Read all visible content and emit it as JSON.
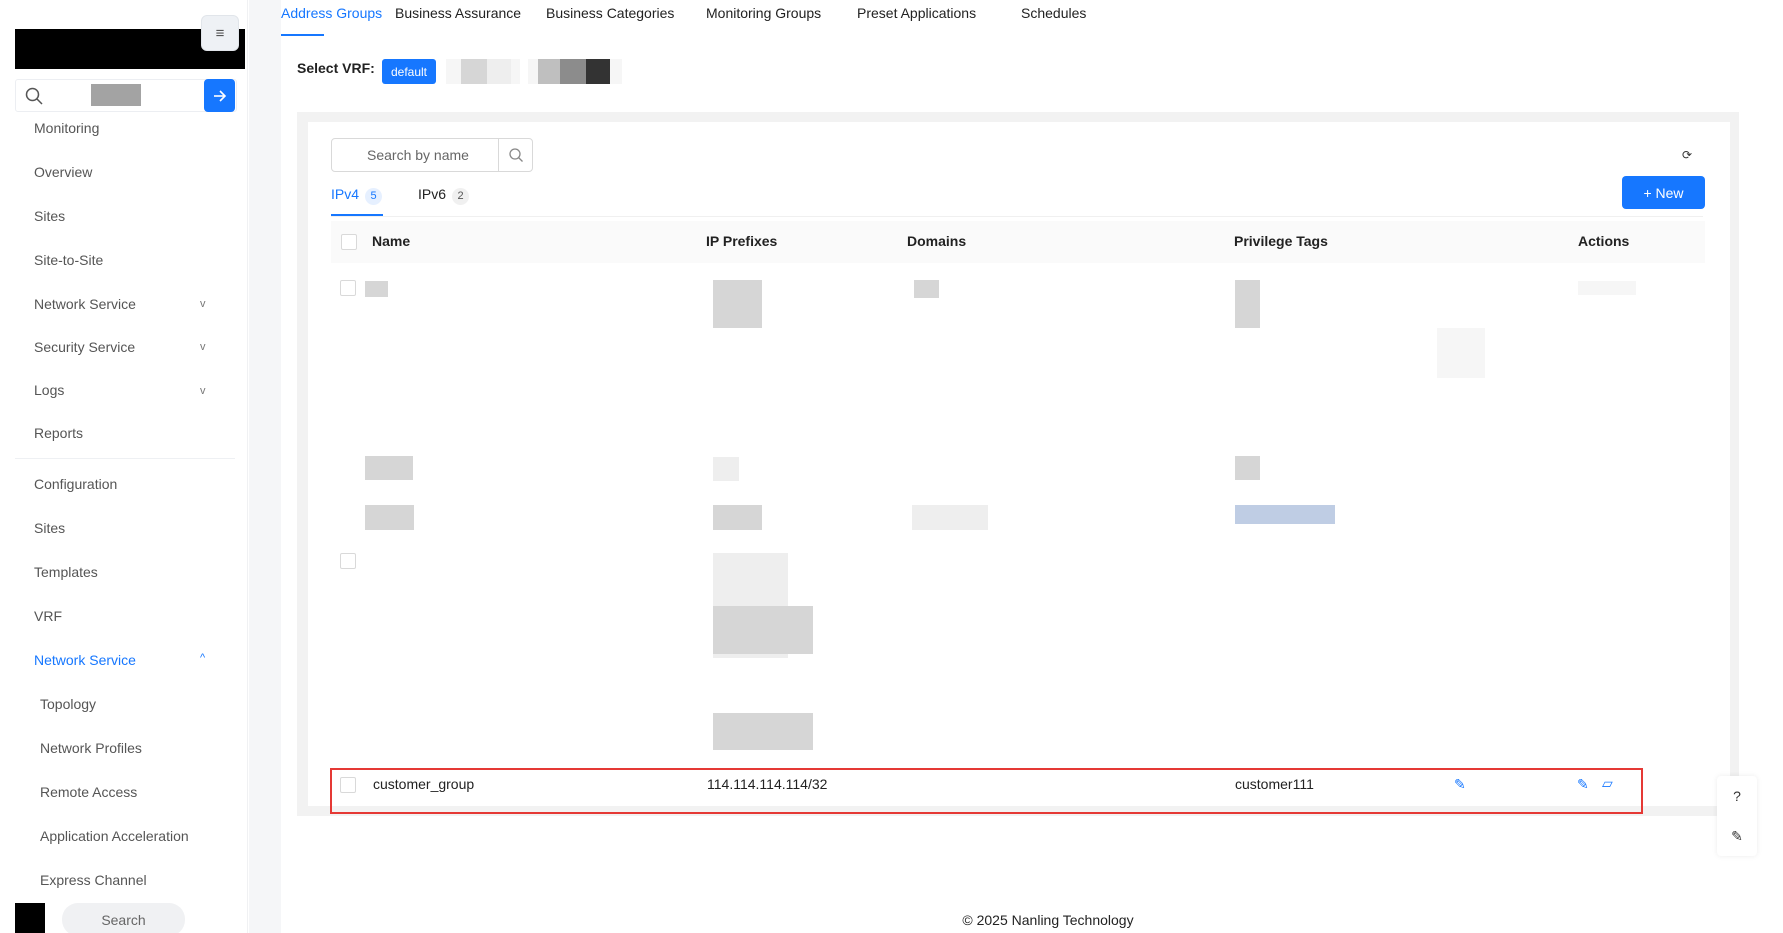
{
  "sidebar": {
    "collapse_icon": "≡",
    "search_go_icon": "arrow-right-icon",
    "items": [
      {
        "label": "Monitoring"
      },
      {
        "label": "Overview"
      },
      {
        "label": "Sites"
      },
      {
        "label": "Site-to-Site"
      },
      {
        "label": "Network Service",
        "caret": "v"
      },
      {
        "label": "Security Service",
        "caret": "v"
      },
      {
        "label": "Logs",
        "caret": "v"
      },
      {
        "label": "Reports"
      },
      {
        "label": "Configuration"
      },
      {
        "label": "Sites"
      },
      {
        "label": "Templates"
      },
      {
        "label": "VRF"
      },
      {
        "label": "Network Service",
        "caret": "^"
      },
      {
        "label": "Topology"
      },
      {
        "label": "Network Profiles"
      },
      {
        "label": "Remote Access"
      },
      {
        "label": "Application Acceleration"
      },
      {
        "label": "Express Channel"
      }
    ],
    "bottom_search": "Search"
  },
  "top_tabs": [
    "Address Groups",
    "Business Assurance",
    "Business Categories",
    "Monitoring Groups",
    "Preset Applications",
    "Schedules"
  ],
  "vrf": {
    "label": "Select VRF:",
    "selected": "default"
  },
  "search": {
    "placeholder": "Search by name"
  },
  "ip_tabs": [
    {
      "label": "IPv4",
      "count": "5"
    },
    {
      "label": "IPv6",
      "count": "2"
    }
  ],
  "new_button": "+ New",
  "table": {
    "columns": [
      "Name",
      "IP Prefixes",
      "Domains",
      "Privilege Tags",
      "Actions"
    ],
    "visible_row": {
      "name": "customer_group",
      "ip_prefix": "114.114.114.114/32",
      "privilege_tag": "customer111"
    }
  },
  "footer": "© 2025 Nanling Technology",
  "float_tools": {
    "help": "?",
    "edit": "✎"
  },
  "colors": {
    "accent": "#1677ff",
    "highlight": "#e53935"
  }
}
